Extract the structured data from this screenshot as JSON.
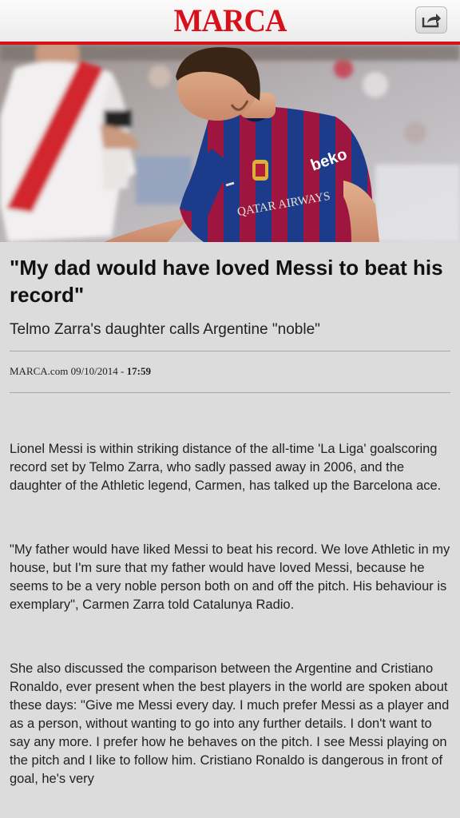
{
  "header": {
    "logo_text": "MARCA",
    "share_icon": "share-icon",
    "brand_color": "#d8101a"
  },
  "hero": {
    "shirt_sponsor": "beko",
    "front_sponsor": "QATAR AIRWAYS"
  },
  "article": {
    "headline": "\"My dad would have loved Messi to beat his record\"",
    "subheadline": "Telmo Zarra's daughter calls Argentine \"noble\"",
    "byline": {
      "source": "MARCA.com",
      "date": "09/10/2014 - ",
      "time": "17:59"
    },
    "paragraphs": [
      "Lionel Messi is within striking distance of the all-time 'La Liga' goalscoring record set by Telmo Zarra, who sadly passed away in 2006, and the daughter of the Athletic legend, Carmen, has talked up the Barcelona ace.",
      "\"My father would have liked Messi to beat his record. We love Athletic in my house, but I'm sure that my father would have loved Messi, because he seems to be a very noble person both on and off the pitch. His behaviour is exemplary\", Carmen Zarra told Catalunya Radio.",
      "She also discussed the comparison between the Argentine and Cristiano Ronaldo, ever present when the best players in the world are spoken about these days: \"Give me Messi every day. I much prefer Messi as a player and as a person, without wanting to go into any further details. I don't want to say any more. I prefer how he behaves on the pitch. I see Messi playing on the pitch and I like to follow him. Cristiano Ronaldo is dangerous in front of goal, he's very"
    ]
  }
}
